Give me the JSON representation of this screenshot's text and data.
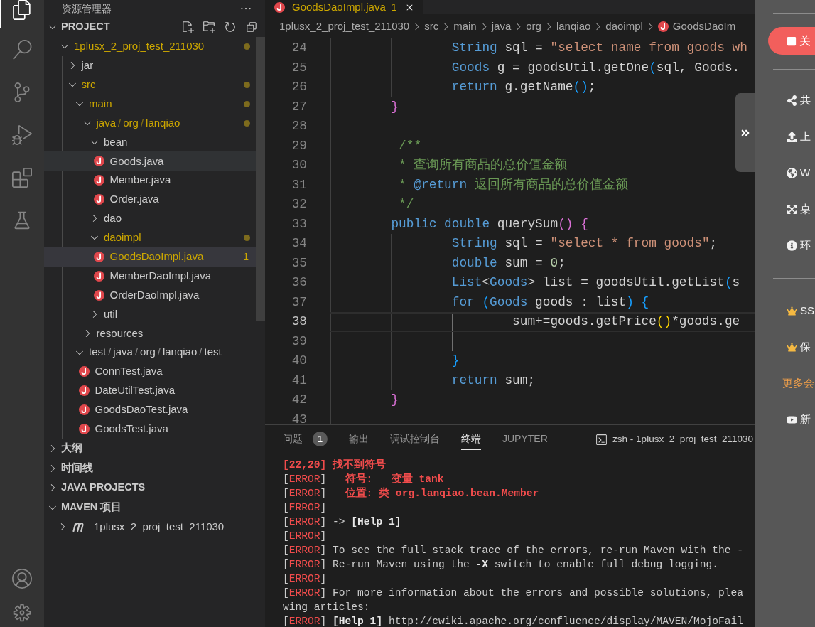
{
  "activity_bar": {
    "items": [
      {
        "kind": "explorer",
        "selected": true
      },
      {
        "kind": "search",
        "selected": false
      },
      {
        "kind": "source_control",
        "selected": false
      },
      {
        "kind": "run_debug",
        "selected": false
      },
      {
        "kind": "extensions",
        "selected": false
      },
      {
        "kind": "testing",
        "selected": false
      }
    ],
    "bottom_items": [
      {
        "kind": "account"
      },
      {
        "kind": "settings"
      }
    ]
  },
  "sidebar": {
    "title": "资源管理器",
    "sections": [
      {
        "title": "PROJECT",
        "expanded": true,
        "tree": [
          {
            "label": "1plusx_2_proj_test_211030",
            "kind": "folder",
            "expanded": true,
            "modified": true,
            "selected": false,
            "hovered": false,
            "children": [
              {
                "label": "jar",
                "kind": "folder",
                "expanded": false,
                "modified": false,
                "selected": false,
                "hovered": false
              },
              {
                "label": "src",
                "kind": "folder",
                "expanded": true,
                "modified": true,
                "selected": false,
                "hovered": false,
                "children": [
                  {
                    "label": "main",
                    "kind": "folder",
                    "expanded": true,
                    "modified": true,
                    "selected": false,
                    "hovered": false,
                    "children": [
                      {
                        "label": "java/org/lanqiao",
                        "kind": "folder",
                        "expanded": true,
                        "modified": true,
                        "selected": false,
                        "hovered": false,
                        "children": [
                          {
                            "label": "bean",
                            "kind": "folder",
                            "expanded": true,
                            "modified": false,
                            "selected": false,
                            "hovered": false,
                            "children": [
                              {
                                "label": "Goods.java",
                                "kind": "java",
                                "modified": false,
                                "selected": false,
                                "hovered": true
                              },
                              {
                                "label": "Member.java",
                                "kind": "java",
                                "modified": false,
                                "selected": false,
                                "hovered": false
                              },
                              {
                                "label": "Order.java",
                                "kind": "java",
                                "modified": false,
                                "selected": false,
                                "hovered": false
                              }
                            ]
                          },
                          {
                            "label": "dao",
                            "kind": "folder",
                            "expanded": false,
                            "modified": false,
                            "selected": false,
                            "hovered": false
                          },
                          {
                            "label": "daoimpl",
                            "kind": "folder",
                            "expanded": true,
                            "modified": true,
                            "selected": false,
                            "hovered": false,
                            "children": [
                              {
                                "label": "GoodsDaoImpl.java",
                                "kind": "java",
                                "modified": true,
                                "badge": "1",
                                "selected": true,
                                "hovered": false
                              },
                              {
                                "label": "MemberDaoImpl.java",
                                "kind": "java",
                                "modified": false,
                                "selected": false,
                                "hovered": false
                              },
                              {
                                "label": "OrderDaoImpl.java",
                                "kind": "java",
                                "modified": false,
                                "selected": false,
                                "hovered": false
                              }
                            ]
                          },
                          {
                            "label": "util",
                            "kind": "folder",
                            "expanded": false,
                            "modified": false,
                            "selected": false,
                            "hovered": false
                          }
                        ]
                      },
                      {
                        "label": "resources",
                        "kind": "folder",
                        "expanded": false,
                        "modified": false,
                        "selected": false,
                        "hovered": false
                      }
                    ]
                  },
                  {
                    "label": "test/java/org/lanqiao/test",
                    "kind": "folder",
                    "expanded": true,
                    "modified": false,
                    "selected": false,
                    "hovered": false,
                    "children": [
                      {
                        "label": "ConnTest.java",
                        "kind": "java",
                        "modified": false,
                        "selected": false,
                        "hovered": false
                      },
                      {
                        "label": "DateUtilTest.java",
                        "kind": "java",
                        "modified": false,
                        "selected": false,
                        "hovered": false
                      },
                      {
                        "label": "GoodsDaoTest.java",
                        "kind": "java",
                        "modified": false,
                        "selected": false,
                        "hovered": false
                      },
                      {
                        "label": "GoodsTest.java",
                        "kind": "java",
                        "modified": false,
                        "selected": false,
                        "hovered": false
                      }
                    ]
                  }
                ]
              }
            ]
          }
        ]
      },
      {
        "title": "大纲",
        "expanded": false
      },
      {
        "title": "时间线",
        "expanded": false
      },
      {
        "title": "JAVA PROJECTS",
        "expanded": false
      },
      {
        "title": "MAVEN 项目",
        "expanded": true,
        "items": [
          {
            "label": "1plusx_2_proj_test_211030",
            "expanded": false
          }
        ]
      }
    ]
  },
  "editor": {
    "tabs": [
      {
        "label": "GoodsDaoImpl.java",
        "kind": "java",
        "badge": "1",
        "modified": true,
        "selected": true
      }
    ],
    "breadcrumb": [
      {
        "label": "1plusx_2_proj_test_211030",
        "kind": "folder"
      },
      {
        "label": "src",
        "kind": "folder"
      },
      {
        "label": "main",
        "kind": "folder"
      },
      {
        "label": "java",
        "kind": "folder"
      },
      {
        "label": "org",
        "kind": "folder"
      },
      {
        "label": "lanqiao",
        "kind": "folder"
      },
      {
        "label": "daoimpl",
        "kind": "folder"
      },
      {
        "label": "GoodsDaoIm",
        "kind": "java"
      }
    ],
    "lines": [
      {
        "number": "24",
        "current": false,
        "tokens": [
          {
            "text": "\t\tString",
            "kind": "keyword"
          },
          {
            "text": " sql = ",
            "kind": "plain"
          },
          {
            "text": "\"select name from goods wh",
            "kind": "string"
          }
        ]
      },
      {
        "number": "25",
        "current": false,
        "tokens": [
          {
            "text": "\t\tGoods",
            "kind": "keyword"
          },
          {
            "text": " g = goodsUtil.getOne",
            "kind": "plain"
          },
          {
            "text": "(",
            "kind": "bracket3"
          },
          {
            "text": "sql, Goods.",
            "kind": "plain"
          }
        ]
      },
      {
        "number": "26",
        "current": false,
        "tokens": [
          {
            "text": "\t\treturn",
            "kind": "keyword"
          },
          {
            "text": " g.getName",
            "kind": "plain"
          },
          {
            "text": "()",
            "kind": "bracket3"
          },
          {
            "text": ";",
            "kind": "plain"
          }
        ]
      },
      {
        "number": "27",
        "current": false,
        "tokens": [
          {
            "text": "\t}",
            "kind": "bracket2"
          }
        ]
      },
      {
        "number": "28",
        "current": false
      },
      {
        "number": "29",
        "current": false,
        "tokens": [
          {
            "text": "\t /**",
            "kind": "comment"
          }
        ]
      },
      {
        "number": "30",
        "current": false,
        "tokens": [
          {
            "text": "\t * 查询所有商品的总价值金额",
            "kind": "comment"
          }
        ]
      },
      {
        "number": "31",
        "current": false,
        "tokens": [
          {
            "text": "\t * ",
            "kind": "comment"
          },
          {
            "text": "@return",
            "kind": "keyword"
          },
          {
            "text": " 返回所有商品的总价值金额",
            "kind": "comment"
          }
        ]
      },
      {
        "number": "32",
        "current": false,
        "tokens": [
          {
            "text": "\t */",
            "kind": "comment"
          }
        ]
      },
      {
        "number": "33",
        "current": false,
        "tokens": [
          {
            "text": "\tpublic double",
            "kind": "keyword"
          },
          {
            "text": " querySum",
            "kind": "plain"
          },
          {
            "text": "() {",
            "kind": "bracket2"
          }
        ]
      },
      {
        "number": "34",
        "current": false,
        "tokens": [
          {
            "text": "\t\tString",
            "kind": "keyword"
          },
          {
            "text": " sql = ",
            "kind": "plain"
          },
          {
            "text": "\"select * from goods\"",
            "kind": "string"
          },
          {
            "text": ";",
            "kind": "plain"
          }
        ]
      },
      {
        "number": "35",
        "current": false,
        "tokens": [
          {
            "text": "\t\tdouble",
            "kind": "keyword"
          },
          {
            "text": " sum = ",
            "kind": "plain"
          },
          {
            "text": "0",
            "kind": "number"
          },
          {
            "text": ";",
            "kind": "plain"
          }
        ]
      },
      {
        "number": "36",
        "current": false,
        "tokens": [
          {
            "text": "\t\tList",
            "kind": "keyword"
          },
          {
            "text": "<",
            "kind": "plain"
          },
          {
            "text": "Goods",
            "kind": "keyword"
          },
          {
            "text": "> list = goodsUtil.getList",
            "kind": "plain"
          },
          {
            "text": "(",
            "kind": "bracket3"
          },
          {
            "text": "s",
            "kind": "plain"
          }
        ]
      },
      {
        "number": "37",
        "current": false,
        "tokens": [
          {
            "text": "\t\tfor ",
            "kind": "keyword"
          },
          {
            "text": "(",
            "kind": "bracket3"
          },
          {
            "text": "Goods",
            "kind": "keyword"
          },
          {
            "text": " goods : list",
            "kind": "plain"
          },
          {
            "text": ") {",
            "kind": "bracket3"
          }
        ]
      },
      {
        "number": "38",
        "current": true,
        "tokens": [
          {
            "text": "\t\t\tsum+=goods.getPrice",
            "kind": "plain"
          },
          {
            "text": "()",
            "kind": "bracket1"
          },
          {
            "text": "*goods.ge",
            "kind": "plain"
          }
        ]
      },
      {
        "number": "39",
        "current": false
      },
      {
        "number": "40",
        "current": false,
        "tokens": [
          {
            "text": "\t\t}",
            "kind": "bracket3"
          }
        ]
      },
      {
        "number": "41",
        "current": false,
        "tokens": [
          {
            "text": "\t\treturn",
            "kind": "keyword"
          },
          {
            "text": " sum;",
            "kind": "plain"
          }
        ]
      },
      {
        "number": "42",
        "current": false,
        "tokens": [
          {
            "text": "\t}",
            "kind": "bracket2"
          }
        ]
      },
      {
        "number": "43",
        "current": false
      }
    ]
  },
  "panel": {
    "tabs": [
      {
        "label": "问题",
        "badge": "1",
        "selected": false
      },
      {
        "label": "输出",
        "selected": false
      },
      {
        "label": "调试控制台",
        "selected": false
      },
      {
        "label": "终端",
        "selected": true
      },
      {
        "label": "JUPYTER",
        "selected": false
      }
    ],
    "terminal": {
      "name": "zsh - 1plusx_2_proj_test_211030",
      "lines": [
        {
          "tokens": [
            {
              "text": "[22,20] 找不到符号",
              "kind": "error_bold"
            }
          ]
        },
        {
          "tokens": [
            {
              "text": "[",
              "kind": "plain"
            },
            {
              "text": "ERROR",
              "kind": "error"
            },
            {
              "text": "]",
              "kind": "plain"
            },
            {
              "text": "   符号:   变量 tank",
              "kind": "error_bold"
            }
          ]
        },
        {
          "tokens": [
            {
              "text": "[",
              "kind": "plain"
            },
            {
              "text": "ERROR",
              "kind": "error"
            },
            {
              "text": "]",
              "kind": "plain"
            },
            {
              "text": "   位置: 类 org.lanqiao.bean.Member",
              "kind": "error_bold"
            }
          ]
        },
        {
          "tokens": [
            {
              "text": "[",
              "kind": "plain"
            },
            {
              "text": "ERROR",
              "kind": "error"
            },
            {
              "text": "]",
              "kind": "plain"
            }
          ]
        },
        {
          "tokens": [
            {
              "text": "[",
              "kind": "plain"
            },
            {
              "text": "ERROR",
              "kind": "error"
            },
            {
              "text": "]",
              "kind": "plain"
            },
            {
              "text": " -> ",
              "kind": "plain"
            },
            {
              "text": "[Help 1]",
              "kind": "bold"
            }
          ]
        },
        {
          "tokens": [
            {
              "text": "[",
              "kind": "plain"
            },
            {
              "text": "ERROR",
              "kind": "error"
            },
            {
              "text": "]",
              "kind": "plain"
            }
          ]
        },
        {
          "tokens": [
            {
              "text": "[",
              "kind": "plain"
            },
            {
              "text": "ERROR",
              "kind": "error"
            },
            {
              "text": "]",
              "kind": "plain"
            },
            {
              "text": " To see the full stack trace of the errors, re-run Maven with the -",
              "kind": "plain"
            }
          ]
        },
        {
          "tokens": [
            {
              "text": "[",
              "kind": "plain"
            },
            {
              "text": "ERROR",
              "kind": "error"
            },
            {
              "text": "]",
              "kind": "plain"
            },
            {
              "text": " Re-run Maven using the ",
              "kind": "plain"
            },
            {
              "text": "-X",
              "kind": "bold"
            },
            {
              "text": " switch to enable full debug logging.",
              "kind": "plain"
            }
          ]
        },
        {
          "tokens": [
            {
              "text": "[",
              "kind": "plain"
            },
            {
              "text": "ERROR",
              "kind": "error"
            },
            {
              "text": "]",
              "kind": "plain"
            }
          ]
        },
        {
          "tokens": [
            {
              "text": "[",
              "kind": "plain"
            },
            {
              "text": "ERROR",
              "kind": "error"
            },
            {
              "text": "]",
              "kind": "plain"
            },
            {
              "text": " For more information about the errors and possible solutions, plea",
              "kind": "plain"
            }
          ]
        },
        {
          "tokens": [
            {
              "text": "wing articles:",
              "kind": "plain"
            }
          ]
        },
        {
          "tokens": [
            {
              "text": "[",
              "kind": "plain"
            },
            {
              "text": "ERROR",
              "kind": "error"
            },
            {
              "text": "] ",
              "kind": "plain"
            },
            {
              "text": "[Help 1]",
              "kind": "bold"
            },
            {
              "text": " http://cwiki.apache.org/confluence/display/MAVEN/MojoFail",
              "kind": "plain"
            }
          ]
        }
      ]
    }
  },
  "side_panel": {
    "stop_button": {
      "label": "关"
    },
    "tools": [
      {
        "kind": "share",
        "label": "共"
      },
      {
        "kind": "upload",
        "label": "上"
      },
      {
        "kind": "globe",
        "label": "W"
      },
      {
        "kind": "fullscreen",
        "label": "桌"
      },
      {
        "kind": "info",
        "label": "环"
      }
    ],
    "extras": [
      {
        "kind": "crown",
        "label": "SS"
      },
      {
        "kind": "crown",
        "label": "保"
      },
      {
        "kind": "link",
        "label": "更多会"
      },
      {
        "kind": "video",
        "label": "新"
      }
    ]
  }
}
